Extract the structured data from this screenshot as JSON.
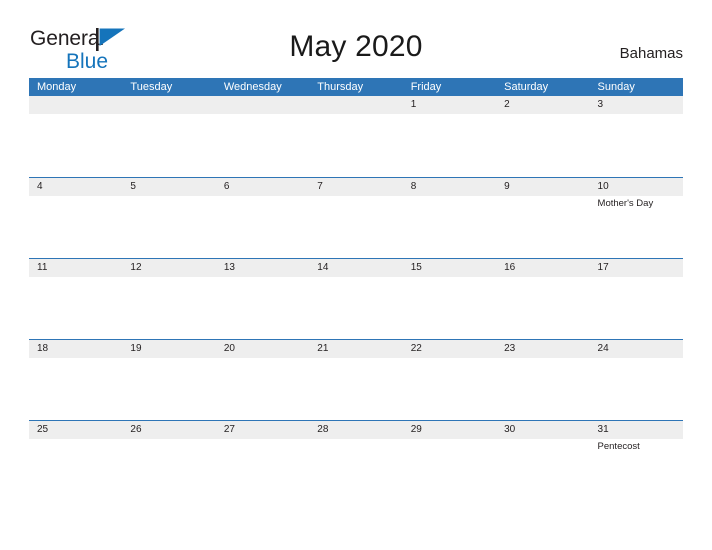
{
  "brand": {
    "name_part1": "General",
    "name_part2": "Blue",
    "flag_icon": "blue-triangle-flag-icon",
    "color_primary": "#1574bb",
    "color_text": "#231f20"
  },
  "header": {
    "title": "May 2020",
    "locale": "Bahamas"
  },
  "calendar": {
    "accent_color": "#2e75b6",
    "band_color": "#eeeeee",
    "weekdays": [
      "Monday",
      "Tuesday",
      "Wednesday",
      "Thursday",
      "Friday",
      "Saturday",
      "Sunday"
    ],
    "weeks": [
      [
        {
          "day": "",
          "events": []
        },
        {
          "day": "",
          "events": []
        },
        {
          "day": "",
          "events": []
        },
        {
          "day": "",
          "events": []
        },
        {
          "day": "1",
          "events": []
        },
        {
          "day": "2",
          "events": []
        },
        {
          "day": "3",
          "events": []
        }
      ],
      [
        {
          "day": "4",
          "events": []
        },
        {
          "day": "5",
          "events": []
        },
        {
          "day": "6",
          "events": []
        },
        {
          "day": "7",
          "events": []
        },
        {
          "day": "8",
          "events": []
        },
        {
          "day": "9",
          "events": []
        },
        {
          "day": "10",
          "events": [
            "Mother's Day"
          ]
        }
      ],
      [
        {
          "day": "11",
          "events": []
        },
        {
          "day": "12",
          "events": []
        },
        {
          "day": "13",
          "events": []
        },
        {
          "day": "14",
          "events": []
        },
        {
          "day": "15",
          "events": []
        },
        {
          "day": "16",
          "events": []
        },
        {
          "day": "17",
          "events": []
        }
      ],
      [
        {
          "day": "18",
          "events": []
        },
        {
          "day": "19",
          "events": []
        },
        {
          "day": "20",
          "events": []
        },
        {
          "day": "21",
          "events": []
        },
        {
          "day": "22",
          "events": []
        },
        {
          "day": "23",
          "events": []
        },
        {
          "day": "24",
          "events": []
        }
      ],
      [
        {
          "day": "25",
          "events": []
        },
        {
          "day": "26",
          "events": []
        },
        {
          "day": "27",
          "events": []
        },
        {
          "day": "28",
          "events": []
        },
        {
          "day": "29",
          "events": []
        },
        {
          "day": "30",
          "events": []
        },
        {
          "day": "31",
          "events": [
            "Pentecost"
          ]
        }
      ]
    ]
  }
}
